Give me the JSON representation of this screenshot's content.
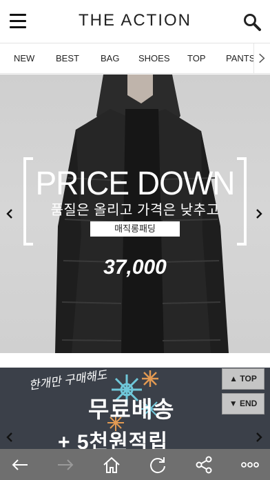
{
  "header": {
    "logo": "THE ACTION",
    "menu_icon": "hamburger-menu-icon",
    "search_icon": "search-icon"
  },
  "categories": [
    "NEW",
    "BEST",
    "BAG",
    "SHOES",
    "TOP",
    "PANTS"
  ],
  "banner1": {
    "headline": "PRICE DOWN",
    "subline": "품질은 올리고 가격은 낮추고",
    "badge": "매직롱패딩",
    "price": "37,000"
  },
  "banner2": {
    "script": "한개만 구매해도",
    "main": "무료배송",
    "sub": "+ 5천원적립"
  },
  "scroll_buttons": {
    "top": "TOP",
    "end": "END"
  },
  "toolbar": {
    "icons": [
      "back-icon",
      "forward-icon",
      "home-icon",
      "refresh-icon",
      "share-icon",
      "more-icon"
    ]
  },
  "colors": {
    "banner2_bg": "#3b4049",
    "toolbar_bg": "#6f6f6f",
    "snowflake_blue": "#6fc7d9",
    "snowflake_orange": "#e39a52"
  }
}
